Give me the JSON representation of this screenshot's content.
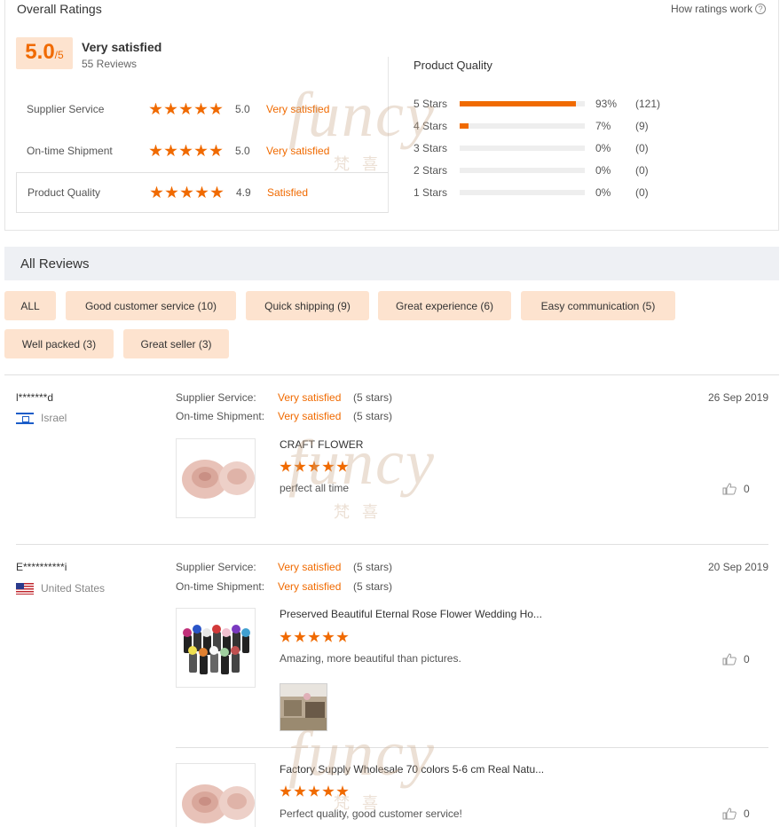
{
  "header": {
    "title": "Overall Ratings",
    "how_ratings": "How ratings work",
    "help_glyph": "?"
  },
  "summary": {
    "score": "5.0",
    "out_of": "/5",
    "label": "Very satisfied",
    "reviews_count": "55 Reviews"
  },
  "metrics": [
    {
      "name": "Supplier Service",
      "score": "5.0",
      "label": "Very satisfied"
    },
    {
      "name": "On-time Shipment",
      "score": "5.0",
      "label": "Very satisfied"
    },
    {
      "name": "Product Quality",
      "score": "4.9",
      "label": "Satisfied"
    }
  ],
  "product_quality": {
    "title": "Product Quality",
    "distribution": [
      {
        "label": "5  Stars",
        "percent": 93,
        "pct_text": "93%",
        "count": "(121)"
      },
      {
        "label": "4  Stars",
        "percent": 7,
        "pct_text": "7%",
        "count": "(9)"
      },
      {
        "label": "3  Stars",
        "percent": 0,
        "pct_text": "0%",
        "count": "(0)"
      },
      {
        "label": "2  Stars",
        "percent": 0,
        "pct_text": "0%",
        "count": "(0)"
      },
      {
        "label": "1  Stars",
        "percent": 0,
        "pct_text": "0%",
        "count": "(0)"
      }
    ]
  },
  "all_reviews": {
    "title": "All Reviews",
    "tags": [
      "ALL",
      "Good customer service (10)",
      "Quick shipping (9)",
      "Great experience (6)",
      "Easy communication (5)",
      "Well packed (3)",
      "Great seller (3)"
    ]
  },
  "reviews": [
    {
      "name": "l*******d",
      "country": "Israel",
      "flag": "flag-israel-icon",
      "date": "26 Sep 2019",
      "supplier_key": "Supplier Service:",
      "supplier_val": "Very satisfied",
      "supplier_stars": "(5 stars)",
      "shipment_key": "On-time Shipment:",
      "shipment_val": "Very satisfied",
      "shipment_stars": "(5 stars)",
      "products": [
        {
          "title": "CRAFT FLOWER",
          "stars": 5,
          "comment": "perfect all time",
          "likes": "0"
        }
      ]
    },
    {
      "name": "E**********i",
      "country": "United States",
      "flag": "flag-us-icon",
      "date": "20 Sep 2019",
      "supplier_key": "Supplier Service:",
      "supplier_val": "Very satisfied",
      "supplier_stars": "(5 stars)",
      "shipment_key": "On-time Shipment:",
      "shipment_val": "Very satisfied",
      "shipment_stars": "(5 stars)",
      "products": [
        {
          "title": "Preserved Beautiful Eternal Rose Flower Wedding Ho...",
          "stars": 5,
          "comment": "Amazing, more beautiful than pictures.",
          "likes": "0"
        },
        {
          "title": "Factory Supply Wholesale 70 colors 5-6 cm Real Natu...",
          "stars": 5,
          "comment": "Perfect quality, good customer service!",
          "likes": "0"
        }
      ]
    }
  ],
  "watermark": {
    "text": "funcy",
    "sub": "梵喜"
  },
  "colors": {
    "accent": "#f06a00",
    "tag_bg": "#fde3cf",
    "section_bg": "#eef0f4"
  }
}
